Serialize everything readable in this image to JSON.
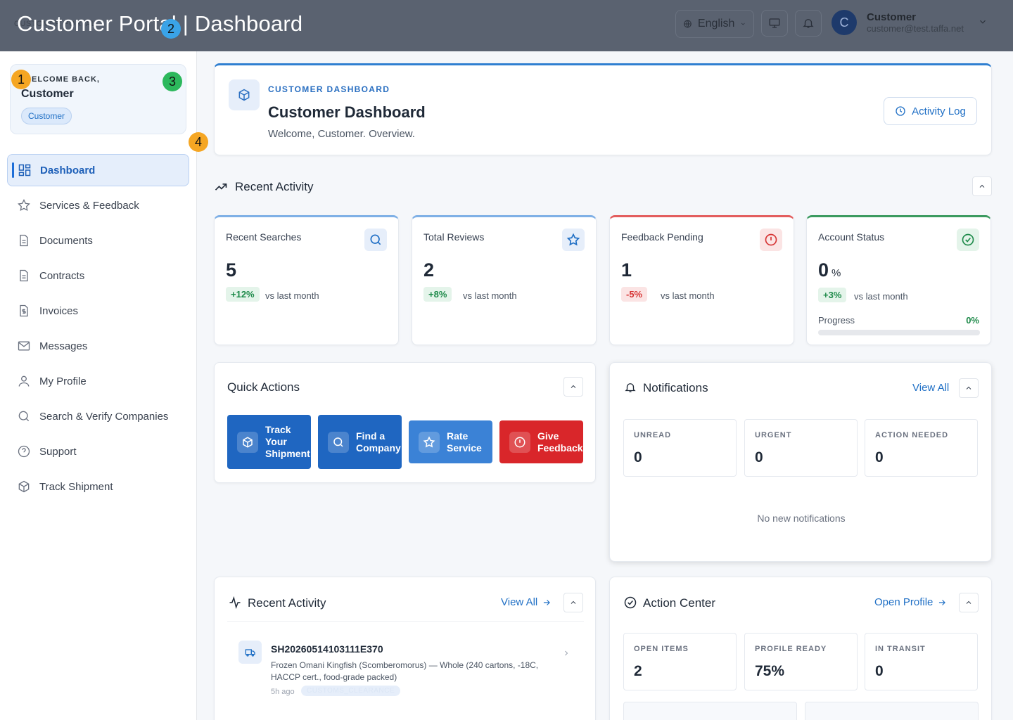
{
  "topbar": {
    "brand_hidden": "CUSTOMER PORTAL",
    "page_title": "Customer Portal | Dashboard",
    "language": "English",
    "user_initial": "C",
    "user_name": "Customer",
    "user_email": "customer@test.taffa.net"
  },
  "markers": [
    "1",
    "2",
    "3",
    "4"
  ],
  "sidebar": {
    "welcome_label": "ELCOME BACK,",
    "welcome_name": "Customer",
    "role_badge": "Customer",
    "items": [
      {
        "label": "Dashboard",
        "icon": "grid-icon",
        "active": true
      },
      {
        "label": "Services & Feedback",
        "icon": "star-icon"
      },
      {
        "label": "Documents",
        "icon": "document-icon"
      },
      {
        "label": "Contracts",
        "icon": "document-icon"
      },
      {
        "label": "Invoices",
        "icon": "invoice-icon"
      },
      {
        "label": "Messages",
        "icon": "mail-icon"
      },
      {
        "label": "My Profile",
        "icon": "user-icon"
      },
      {
        "label": "Search & Verify Companies",
        "icon": "search-icon"
      },
      {
        "label": "Support",
        "icon": "help-icon"
      },
      {
        "label": "Track Shipment",
        "icon": "box-icon"
      }
    ]
  },
  "hero": {
    "kicker": "CUSTOMER DASHBOARD",
    "title": "Customer Dashboard",
    "subtitle": "Welcome, Customer. Overview.",
    "activity_button": "Activity Log"
  },
  "recent_activity_section": {
    "title": "Recent Activity"
  },
  "stats": [
    {
      "label": "Recent Searches",
      "value": "5",
      "change": "+12%",
      "vs": "vs last month",
      "accent": "#7fb0e6",
      "icon": "search-icon"
    },
    {
      "label": "Total Reviews",
      "value": "2",
      "change": "+8%",
      "vs": "vs last month",
      "accent": "#7fb0e6",
      "icon": "star-icon"
    },
    {
      "label": "Feedback Pending",
      "value": "1",
      "change": "-5%",
      "vs": "vs last month",
      "accent": "#e35d5d",
      "icon": "alert-icon"
    },
    {
      "label": "Account Status",
      "value": "0",
      "unit": "%",
      "change": "+3%",
      "vs": "vs last month",
      "accent": "#3b9a5f",
      "icon": "check-circle-icon",
      "progress_label": "Progress",
      "progress_value": "0%",
      "progress_fraction": 0
    }
  ],
  "quick_actions": {
    "title": "Quick Actions",
    "buttons": [
      {
        "label": "Track Your Shipment",
        "color": "#1f66c1",
        "icon": "box-icon"
      },
      {
        "label": "Find a Company",
        "color": "#1f66c1",
        "icon": "search-icon"
      },
      {
        "label": "Rate Service",
        "color": "#3b82d6",
        "icon": "star-icon"
      },
      {
        "label": "Give Feedback",
        "color": "#d9262a",
        "icon": "alert-icon"
      }
    ]
  },
  "notifications": {
    "title": "Notifications",
    "view_all": "View All",
    "counters": [
      {
        "label": "UNREAD",
        "value": "0"
      },
      {
        "label": "URGENT",
        "value": "0"
      },
      {
        "label": "ACTION NEEDED",
        "value": "0"
      }
    ],
    "empty": "No new notifications"
  },
  "recent_activity": {
    "title": "Recent Activity",
    "view_all": "View All",
    "items": [
      {
        "id": "SH20260514103111E370",
        "desc": "Frozen Omani Kingfish (Scomberomorus) — Whole (240 cartons, -18C, HACCP cert., food-grade packed)",
        "time": "5h ago",
        "status": "CUSTOMS_CLEARANCE"
      }
    ]
  },
  "action_center": {
    "title": "Action Center",
    "open_profile": "Open Profile",
    "counters": [
      {
        "label": "OPEN ITEMS",
        "value": "2"
      },
      {
        "label": "PROFILE READY",
        "value": "75%"
      },
      {
        "label": "IN TRANSIT",
        "value": "0"
      }
    ]
  }
}
